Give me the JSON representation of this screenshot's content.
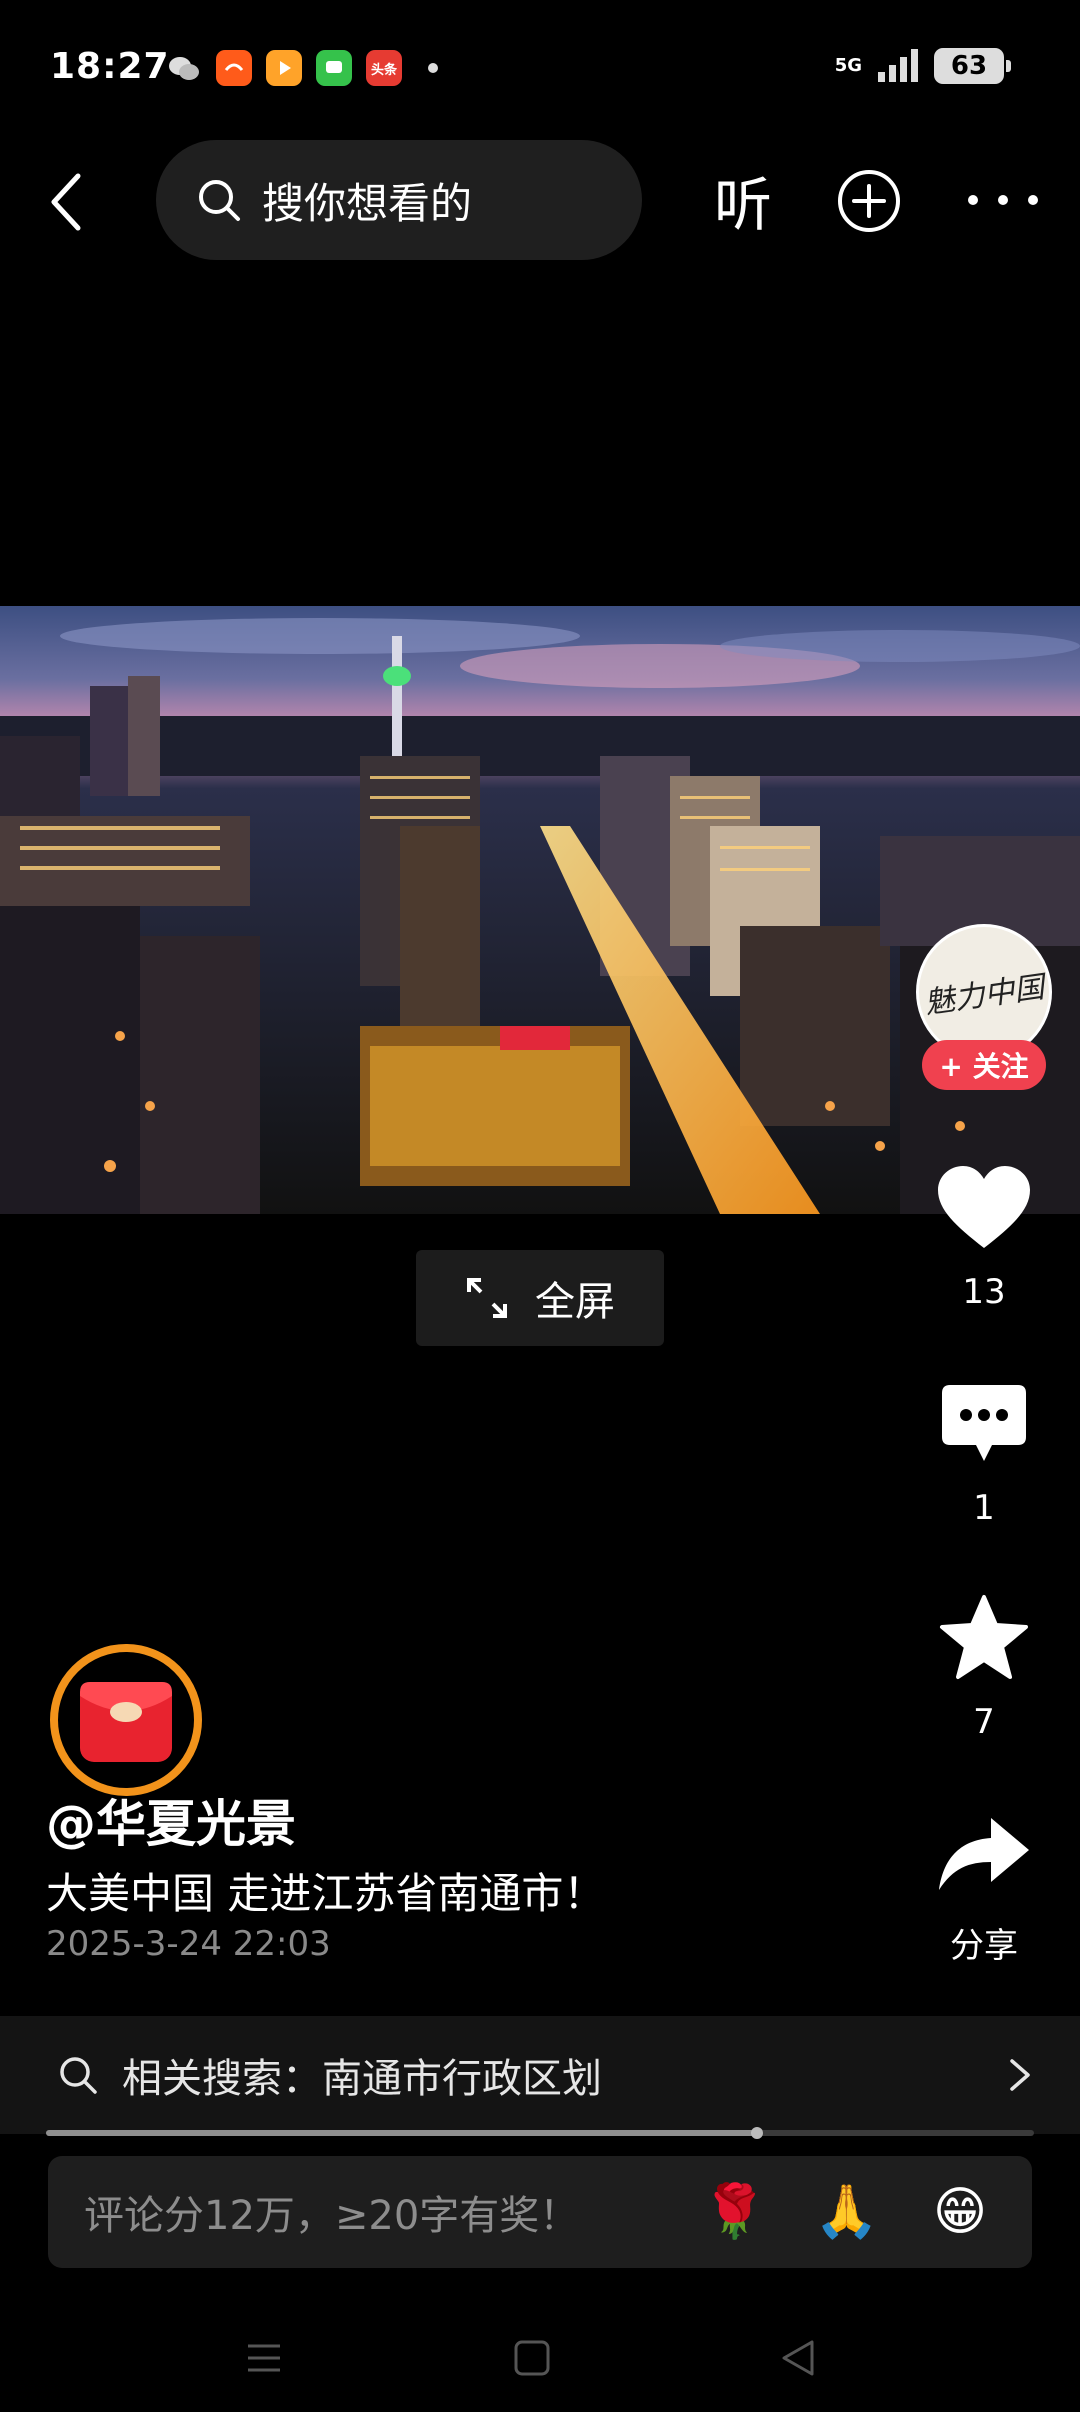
{
  "status_bar": {
    "time": "18:27",
    "network": "5G",
    "battery": "63",
    "notifications": [
      {
        "name": "wechat-icon",
        "label": "",
        "color": "#2c2c2c"
      },
      {
        "name": "taobao-icon",
        "label": "",
        "color": "#ff5b1a"
      },
      {
        "name": "video-app-icon",
        "label": "",
        "color": "#ff9f2b"
      },
      {
        "name": "messages-icon",
        "label": "",
        "color": "#35c24b"
      },
      {
        "name": "toutiao-icon",
        "label": "头条",
        "color": "#e63b32"
      }
    ]
  },
  "top_nav": {
    "search_placeholder": "搜你想看的",
    "listen_label": "听"
  },
  "video": {
    "fullscreen_label": "全屏"
  },
  "author": {
    "avatar_text": "魅力中国",
    "follow_label": "+ 关注",
    "name": "@华夏光景"
  },
  "actions": {
    "likes": "13",
    "comments": "1",
    "favorites": "7",
    "share_label": "分享"
  },
  "post": {
    "title": "大美中国 走进江苏省南通市！",
    "date": "2025-3-24 22:03"
  },
  "related": {
    "text": "相关搜索：南通市行政区划"
  },
  "progress": {
    "fraction": 0.72
  },
  "comment": {
    "placeholder": "评论分12万，≥20字有奖！",
    "emojis": [
      "🌹",
      "🙏",
      "😁"
    ]
  },
  "colors": {
    "accent": "#f0414f",
    "redpacket_ring": "#f2931b"
  }
}
